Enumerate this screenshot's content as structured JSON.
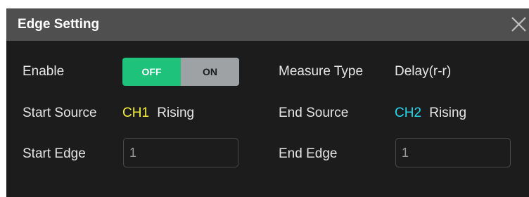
{
  "dialog": {
    "title": "Edge Setting"
  },
  "icons": {
    "close": "close-icon"
  },
  "fields": {
    "enable": {
      "label": "Enable",
      "off_label": "OFF",
      "on_label": "ON",
      "selected": "OFF"
    },
    "measure_type": {
      "label": "Measure Type",
      "value": "Delay(r-r)"
    },
    "start_source": {
      "label": "Start Source",
      "channel": "CH1",
      "edge": "Rising"
    },
    "end_source": {
      "label": "End Source",
      "channel": "CH2",
      "edge": "Rising"
    },
    "start_edge": {
      "label": "Start Edge",
      "value": "1"
    },
    "end_edge": {
      "label": "End Edge",
      "value": "1"
    }
  },
  "colors": {
    "toggle_active": "#1ec27a",
    "toggle_inactive": "#9ea2a4",
    "ch1": "#f5f03a",
    "ch2": "#27d7ee",
    "title_bar": "#4f4f4f",
    "panel_bg": "#1c1c1c"
  }
}
